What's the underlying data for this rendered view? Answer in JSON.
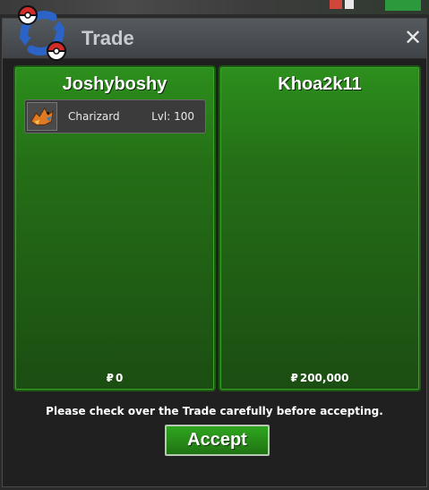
{
  "window": {
    "title": "Trade",
    "close_symbol": "✕",
    "logo_icon": "trade-pokeball-swap-icon"
  },
  "left_panel": {
    "player_name": "Joshyboshy",
    "items": [
      {
        "icon": "charizard-icon",
        "name": "Charizard",
        "level": "Lvl: 100"
      }
    ],
    "currency_symbol": "₽",
    "money": "0"
  },
  "right_panel": {
    "player_name": "Khoa2k11",
    "items": [],
    "currency_symbol": "₽",
    "money": "200,000"
  },
  "footer": {
    "notice": "Please check over the Trade carefully before accepting.",
    "accept_label": "Accept"
  },
  "colors": {
    "panel_green": "#2c8f1c",
    "panel_border": "#1d5a12",
    "accept_green": "#2fa61f",
    "pokeball_red": "#d42a2a",
    "swap_blue": "#2b63c6"
  }
}
